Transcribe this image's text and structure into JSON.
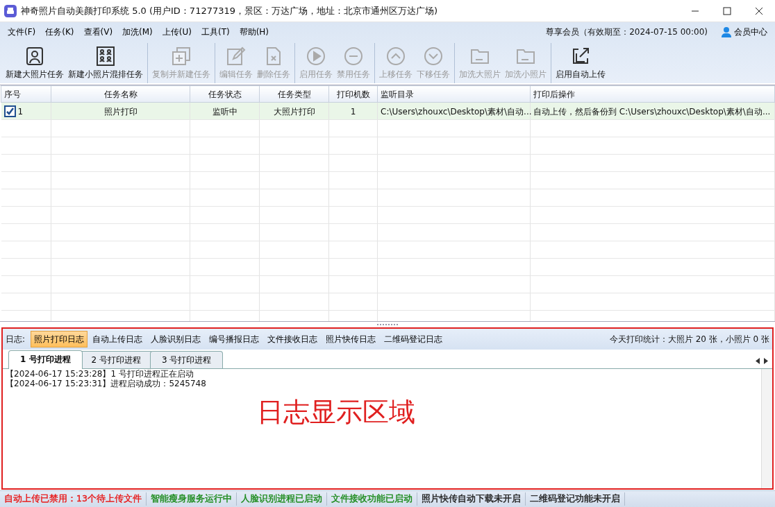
{
  "window": {
    "title": "神奇照片自动美颜打印系统 5.0 (用户ID：71277319，景区：万达广场，地址：北京市通州区万达广场)"
  },
  "menu": [
    "文件(F)",
    "任务(K)",
    "查看(V)",
    "加洗(M)",
    "上传(U)",
    "工具(T)",
    "帮助(H)"
  ],
  "membership": {
    "text": "尊享会员（有效期至：2024-07-15 00:00)",
    "link": "会员中心"
  },
  "toolbar": [
    [
      {
        "label": "新建大照片任务",
        "disabled": false
      },
      {
        "label": "新建小照片混排任务",
        "disabled": false
      }
    ],
    [
      {
        "label": "复制并新建任务",
        "disabled": true
      }
    ],
    [
      {
        "label": "编辑任务",
        "disabled": true
      },
      {
        "label": "删除任务",
        "disabled": true
      }
    ],
    [
      {
        "label": "启用任务",
        "disabled": true
      },
      {
        "label": "禁用任务",
        "disabled": true
      }
    ],
    [
      {
        "label": "上移任务",
        "disabled": true
      },
      {
        "label": "下移任务",
        "disabled": true
      }
    ],
    [
      {
        "label": "加洗大照片",
        "disabled": true
      },
      {
        "label": "加洗小照片",
        "disabled": true
      }
    ],
    [
      {
        "label": "启用自动上传",
        "disabled": false
      }
    ]
  ],
  "table": {
    "columns": [
      "序号",
      "任务名称",
      "任务状态",
      "任务类型",
      "打印机数",
      "监听目录",
      "打印后操作"
    ],
    "rows": [
      {
        "checked": true,
        "cells": [
          "1",
          "照片打印",
          "监听中",
          "大照片打印",
          "1",
          "C:\\Users\\zhouxc\\Desktop\\素材\\自动...",
          "自动上传，然后备份到 C:\\Users\\zhouxc\\Desktop\\素材\\自动..."
        ]
      }
    ]
  },
  "log": {
    "label": "日志:",
    "tabs": [
      {
        "label": "照片打印日志",
        "selected": true
      },
      {
        "label": "自动上传日志",
        "selected": false
      },
      {
        "label": "人脸识别日志",
        "selected": false
      },
      {
        "label": "编号播报日志",
        "selected": false
      },
      {
        "label": "文件接收日志",
        "selected": false
      },
      {
        "label": "照片快传日志",
        "selected": false
      },
      {
        "label": "二维码登记日志",
        "selected": false
      }
    ],
    "stats": "今天打印统计：大照片 20 张，小照片 0 张",
    "process_tabs": [
      {
        "label": "1 号打印进程",
        "selected": true
      },
      {
        "label": "2 号打印进程",
        "selected": false
      },
      {
        "label": "3 号打印进程",
        "selected": false
      }
    ],
    "lines": [
      "【2024-06-17 15:23:28】1 号打印进程正在启动",
      "【2024-06-17 15:23:31】进程启动成功：5245748"
    ],
    "overlay": "日志显示区域"
  },
  "status_bar": [
    {
      "text": "自动上传已禁用：13个待上传文件",
      "color": "#e81818"
    },
    {
      "text": "智能瘦身服务运行中",
      "color": "#1a8a1a"
    },
    {
      "text": "人脸识别进程已启动",
      "color": "#1a8a1a"
    },
    {
      "text": "文件接收功能已启动",
      "color": "#1a8a1a"
    },
    {
      "text": "照片快传自动下载未开启",
      "color": "#202020"
    },
    {
      "text": "二维码登记功能未开启",
      "color": "#202020"
    }
  ]
}
